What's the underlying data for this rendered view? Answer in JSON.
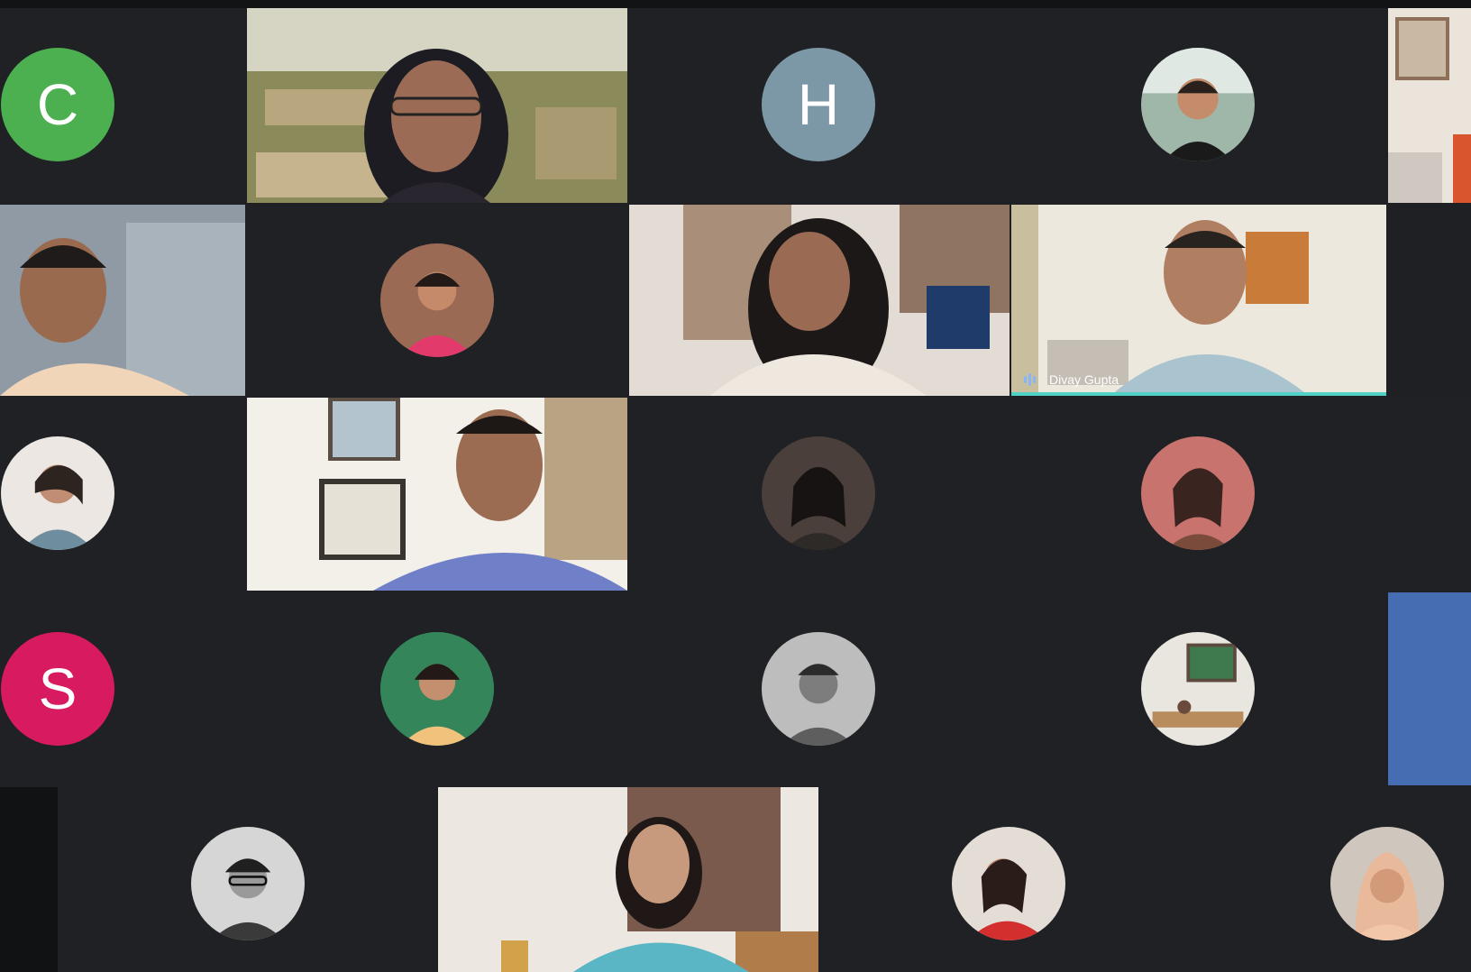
{
  "app": {
    "background_color": "#1f2023"
  },
  "participants": [
    {
      "id": "c",
      "initial": "C",
      "avatar_color": "#4caf50"
    },
    {
      "id": "h",
      "initial": "H",
      "avatar_color": "#7c98a6"
    },
    {
      "id": "s",
      "initial": "S",
      "avatar_color": "#d81b60"
    }
  ],
  "active_speaker": {
    "name": "Divay Gupta",
    "indicator_color": "#4fd1c5"
  }
}
